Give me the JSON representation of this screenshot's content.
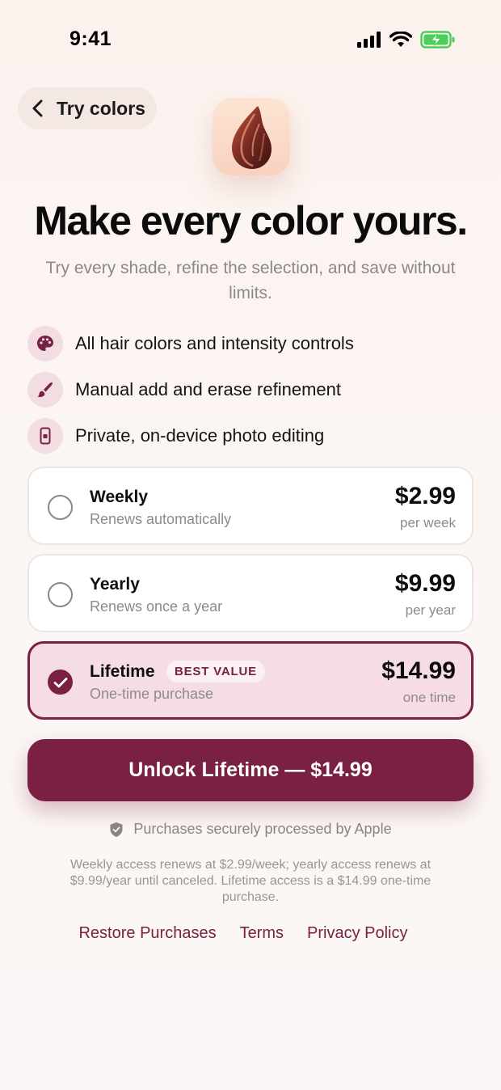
{
  "status_bar": {
    "time": "9:41"
  },
  "nav": {
    "back_label": "Try colors"
  },
  "header": {
    "headline": "Make every color yours.",
    "subhead": "Try every shade, refine the selection, and save without limits."
  },
  "features": [
    {
      "icon": "palette-icon",
      "text": "All hair colors and intensity controls"
    },
    {
      "icon": "brush-icon",
      "text": "Manual add and erase refinement"
    },
    {
      "icon": "phone-icon",
      "text": "Private, on-device photo editing"
    }
  ],
  "plans": [
    {
      "name": "Weekly",
      "desc": "Renews automatically",
      "price": "$2.99",
      "per": "per week",
      "selected": false
    },
    {
      "name": "Yearly",
      "desc": "Renews once a year",
      "price": "$9.99",
      "per": "per year",
      "selected": false
    },
    {
      "name": "Lifetime",
      "badge": "BEST VALUE",
      "desc": "One-time purchase",
      "price": "$14.99",
      "per": "one time",
      "selected": true
    }
  ],
  "cta": {
    "label": "Unlock Lifetime — $14.99"
  },
  "secure_text": "Purchases securely processed by Apple",
  "legal_text": "Weekly access renews at $2.99/week; yearly access renews at $9.99/year until canceled. Lifetime access is a $14.99 one-time purchase.",
  "links": {
    "restore": "Restore Purchases",
    "terms": "Terms",
    "privacy": "Privacy Policy"
  },
  "colors": {
    "accent": "#7a2042",
    "accent_light": "#f5dde3",
    "background": "#fcf6f3"
  }
}
